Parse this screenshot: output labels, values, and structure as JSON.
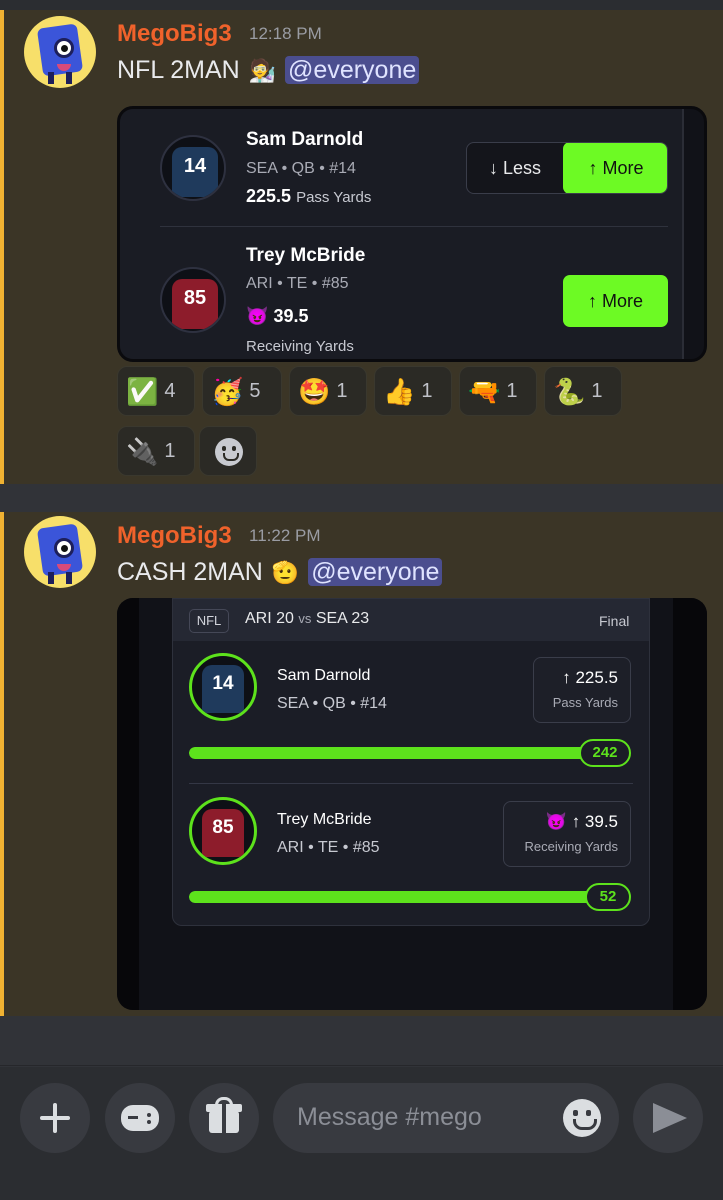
{
  "messages": [
    {
      "username": "MegoBig3",
      "time": "12:18 PM",
      "text": "NFL 2MAN",
      "emoji": "🧑‍🔬",
      "mention": "@everyone",
      "embed": {
        "players": [
          {
            "name": "Sam Darnold",
            "info": "SEA • QB • #14",
            "jersey_number": "14",
            "line": "225.5",
            "stat": "Pass Yards",
            "less_label": "↓ Less",
            "more_label": "↑ More"
          },
          {
            "name": "Trey McBride",
            "info": "ARI • TE • #85",
            "jersey_number": "85",
            "badge_emoji": "😈",
            "line": "39.5",
            "stat": "Receiving Yards",
            "more_label": "↑ More"
          }
        ]
      },
      "reactions": [
        {
          "emoji": "✅",
          "count": "4"
        },
        {
          "emoji": "🥳",
          "count": "5"
        },
        {
          "emoji": "🤩",
          "count": "1"
        },
        {
          "emoji": "👍",
          "count": "1"
        },
        {
          "emoji": "🔫",
          "count": "1"
        },
        {
          "emoji": "🐍",
          "count": "1"
        },
        {
          "emoji": "🔌",
          "count": "1"
        }
      ]
    },
    {
      "username": "MegoBig3",
      "time": "11:22 PM",
      "text": "CASH 2MAN",
      "emoji": "🫡",
      "mention": "@everyone",
      "embed": {
        "league": "NFL",
        "score_left": "ARI 20",
        "score_vs": "vs",
        "score_right": "SEA 23",
        "status": "Final",
        "players": [
          {
            "name": "Sam Darnold",
            "info": "SEA • QB • #14",
            "jersey_number": "14",
            "line_text": "↑ 225.5",
            "stat": "Pass Yards",
            "result": "242",
            "progress": 1.0
          },
          {
            "name": "Trey McBride",
            "info": "ARI • TE • #85",
            "jersey_number": "85",
            "badge_emoji": "😈",
            "line_text": "↑ 39.5",
            "stat": "Receiving Yards",
            "result": "52",
            "progress": 1.0
          }
        ]
      }
    }
  ],
  "composer": {
    "placeholder": "Message #mego"
  },
  "colors": {
    "accent_green": "#6dfa24",
    "username_orange": "#f0622b",
    "mention_bg": "#4b4e8f",
    "highlight_border": "#f0b232"
  }
}
